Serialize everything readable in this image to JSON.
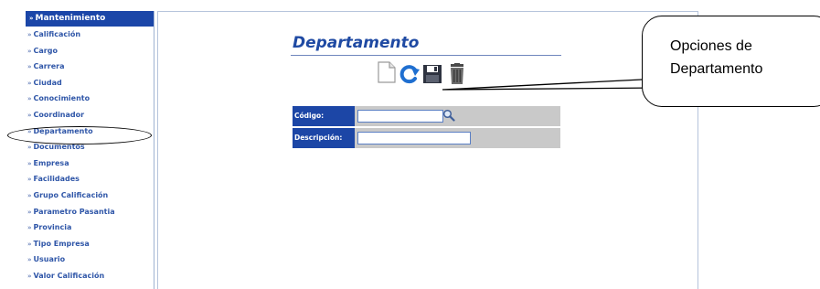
{
  "sidebar": {
    "header": "Mantenimiento",
    "items": [
      {
        "label": "Calificación"
      },
      {
        "label": "Cargo"
      },
      {
        "label": "Carrera"
      },
      {
        "label": "Ciudad"
      },
      {
        "label": "Conocimiento"
      },
      {
        "label": "Coordinador"
      },
      {
        "label": "Departamento"
      },
      {
        "label": "Documentos"
      },
      {
        "label": "Empresa"
      },
      {
        "label": "Facilidades"
      },
      {
        "label": "Grupo Calificación"
      },
      {
        "label": "Parametro Pasantia"
      },
      {
        "label": "Provincia"
      },
      {
        "label": "Tipo Empresa"
      },
      {
        "label": "Usuario"
      },
      {
        "label": "Valor Calificación"
      }
    ]
  },
  "main": {
    "title": "Departamento",
    "toolbar": {
      "icons": [
        "new-icon",
        "refresh-icon",
        "save-icon",
        "delete-icon"
      ]
    },
    "form": {
      "codigo_label": "Código:",
      "codigo_value": "",
      "descripcion_label": "Descripción:",
      "descripcion_value": ""
    }
  },
  "callout": {
    "line1": "Opciones de",
    "line2": "Departamento"
  },
  "colors": {
    "accent": "#1c46a6",
    "link": "#2f56a8",
    "form_row": "#c9c9c9"
  }
}
